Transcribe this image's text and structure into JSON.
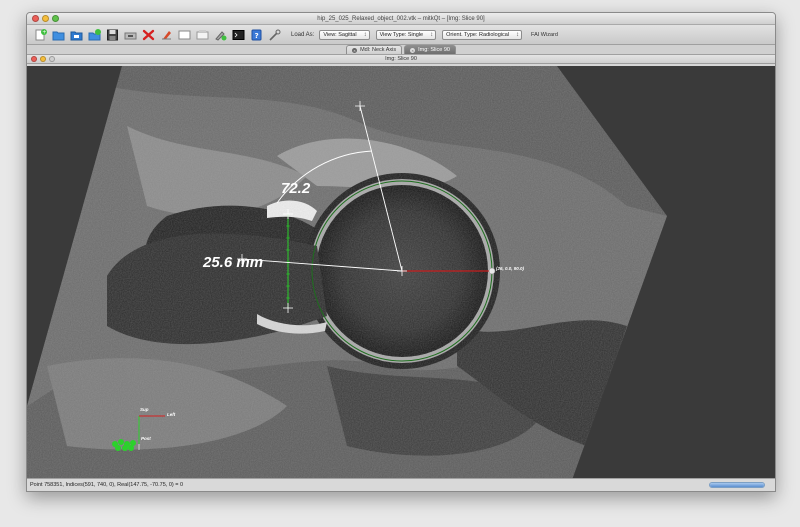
{
  "window": {
    "title": "hip_25_025_Relaxed_object_002.vtk – mitkQt – [Img: Slice 90]"
  },
  "toolbar": {
    "load_as_label": "Load As:",
    "view_select": "View: Sagittal",
    "view_type_select": "View Type: Single",
    "orient_select": "Orient. Type: Radiological",
    "fai_wizard": "FAI Wizard",
    "icons": [
      "new-file-icon",
      "open-folder-icon",
      "open-folder-blue-icon",
      "add-folder-icon",
      "save-disk-icon",
      "screenshot-icon",
      "delete-x-icon",
      "erase-icon",
      "window-icon",
      "window-alt-icon",
      "pen-add-icon",
      "terminal-icon",
      "help-icon",
      "tool-icon"
    ]
  },
  "tabs": [
    {
      "label": "Mdl: Neck Axis",
      "active": false
    },
    {
      "label": "Img: Slice 90",
      "active": true
    }
  ],
  "subwindow": {
    "title": "Img: Slice 90"
  },
  "overlay": {
    "angle_label": "72.2",
    "distance_label": "25.6  mm",
    "point_label": "(26, 0.0, 90.0)",
    "orientation": {
      "sup": "Sup",
      "left": "Left",
      "post": "Post"
    }
  },
  "status": {
    "text": "Point 758351, Indices(591, 740, 0), Real(147.75, -70.75, 0) = 0",
    "progress_pct": 100
  },
  "colors": {
    "measure_white": "#ffffff",
    "radius_red": "#c81e1e",
    "circle_green": "#1e6e1e",
    "axis_green": "#2bd12b"
  }
}
